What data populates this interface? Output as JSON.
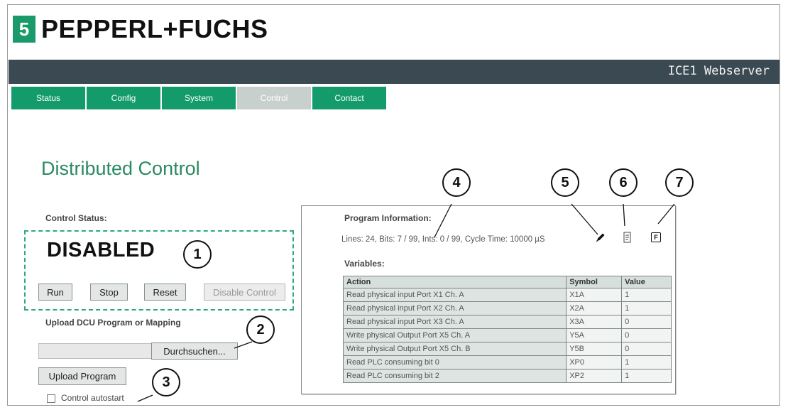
{
  "brand": {
    "logo_glyph": "5",
    "logo_text": "PEPPERL+FUCHS",
    "color": "#1a9a6a"
  },
  "header": {
    "title": "ICE1 Webserver",
    "bar_color": "#3b4a52"
  },
  "tabs": [
    {
      "label": "Status",
      "active": false
    },
    {
      "label": "Config",
      "active": false
    },
    {
      "label": "System",
      "active": false
    },
    {
      "label": "Control",
      "active": true
    },
    {
      "label": "Contact",
      "active": false
    }
  ],
  "page": {
    "title": "Distributed Control",
    "control_status_label": "Control Status:",
    "status_value": "DISABLED",
    "buttons": {
      "run": "Run",
      "stop": "Stop",
      "reset": "Reset",
      "disable_control": "Disable Control"
    },
    "upload_label": "Upload DCU Program or Mapping",
    "browse_button": "Durchsuchen...",
    "upload_button": "Upload Program",
    "autostart_label": "Control autostart",
    "autostart_checked": false
  },
  "program_panel": {
    "title": "Program Information:",
    "info": "Lines: 24, Bits: 7 / 99, Ints: 0 / 99, Cycle Time: 10000 µS",
    "icons": [
      "pencil-icon",
      "document-icon",
      "f-icon"
    ],
    "variables_label": "Variables:",
    "columns": [
      "Action",
      "Symbol",
      "Value"
    ],
    "rows": [
      [
        "Read physical input Port X1 Ch. A",
        "X1A",
        "1"
      ],
      [
        "Read physical input Port X2 Ch. A",
        "X2A",
        "1"
      ],
      [
        "Read physical input Port X3 Ch. A",
        "X3A",
        "0"
      ],
      [
        "Write physical Output Port X5 Ch. A",
        "Y5A",
        "0"
      ],
      [
        "Write physical Output Port X5 Ch. B",
        "Y5B",
        "0"
      ],
      [
        "Read PLC consuming bit 0",
        "XP0",
        "1"
      ],
      [
        "Read PLC consuming bit 2",
        "XP2",
        "1"
      ]
    ]
  },
  "callouts": [
    "1",
    "2",
    "3",
    "4",
    "5",
    "6",
    "7"
  ]
}
